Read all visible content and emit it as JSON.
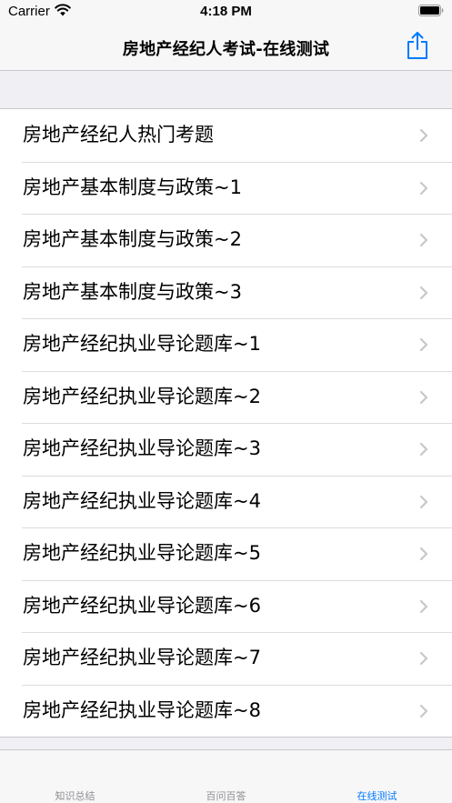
{
  "status_bar": {
    "carrier": "Carrier",
    "time": "4:18 PM"
  },
  "nav": {
    "title": "房地产经纪人考试-在线测试",
    "share_icon": "share-icon"
  },
  "list": {
    "items": [
      {
        "label": "房地产经纪人热门考题"
      },
      {
        "label": "房地产基本制度与政策~1"
      },
      {
        "label": "房地产基本制度与政策~2"
      },
      {
        "label": "房地产基本制度与政策~3"
      },
      {
        "label": "房地产经纪执业导论题库~1"
      },
      {
        "label": "房地产经纪执业导论题库~2"
      },
      {
        "label": "房地产经纪执业导论题库~3"
      },
      {
        "label": "房地产经纪执业导论题库~4"
      },
      {
        "label": "房地产经纪执业导论题库~5"
      },
      {
        "label": "房地产经纪执业导论题库~6"
      },
      {
        "label": "房地产经纪执业导论题库~7"
      },
      {
        "label": "房地产经纪执业导论题库~8"
      }
    ]
  },
  "tabs": [
    {
      "label": "知识总结",
      "active": false
    },
    {
      "label": "百问百答",
      "active": false
    },
    {
      "label": "在线测试",
      "active": true
    }
  ],
  "colors": {
    "accent": "#007aff",
    "inactive_tab": "#8e8e93",
    "background": "#efeff4",
    "chevron": "#c7c7cc"
  }
}
